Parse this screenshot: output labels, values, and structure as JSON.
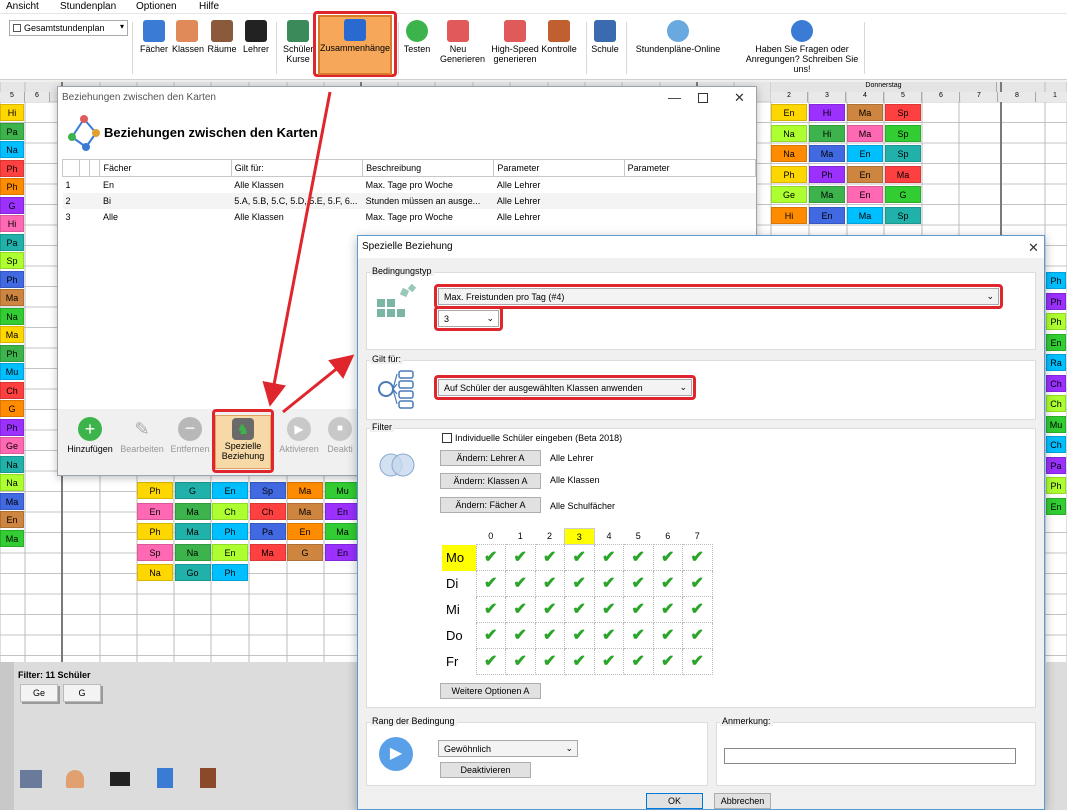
{
  "menu": [
    "Ansicht",
    "Stundenplan",
    "Optionen",
    "Hilfe"
  ],
  "plan_select": "Gesamtstundenplan",
  "toolbar": [
    {
      "label": "Fächer",
      "icon": "subjects-book-icon",
      "color": "#3a7bd5"
    },
    {
      "label": "Klassen",
      "icon": "classes-people-icon",
      "color": "#e08a5a"
    },
    {
      "label": "Räume",
      "icon": "rooms-door-icon",
      "color": "#8a5a3a"
    },
    {
      "label": "Lehrer",
      "icon": "teacher-hat-icon",
      "color": "#222"
    },
    {
      "label": "Schüler\nKurse",
      "icon": "students-icon",
      "color": "#3a8a5a"
    },
    {
      "label": "Zusammenhänge",
      "icon": "relations-network-icon",
      "color": "#2a6ad0"
    },
    {
      "label": "Testen",
      "icon": "test-check-icon",
      "color": "#3cb44b"
    },
    {
      "label": "Neu\nGenerieren",
      "icon": "generate-icon",
      "color": "#e05a5a"
    },
    {
      "label": "High-Speed\ngenerieren",
      "icon": "highspeed-icon",
      "color": "#e05a5a"
    },
    {
      "label": "Kontrolle",
      "icon": "gavel-icon",
      "color": "#c06030"
    },
    {
      "label": "Schule",
      "icon": "school-building-icon",
      "color": "#3a6ab0"
    },
    {
      "label": "Stundenpläne-Online",
      "icon": "cloud-icon",
      "color": "#6aa8e0"
    },
    {
      "label": "Haben Sie Fragen oder\nAnregungen? Schreiben Sie uns!",
      "icon": "question-icon",
      "color": "#3a7bd5"
    }
  ],
  "grid": {
    "day_header": "Donnerstag",
    "period_labels_left": [
      "5",
      "6"
    ],
    "period_labels_right": [
      "2",
      "3",
      "4",
      "5",
      "6",
      "7",
      "8",
      "1"
    ]
  },
  "dialog1": {
    "window_title": "Beziehungen zwischen den Karten",
    "heading": "Beziehungen zwischen den Karten",
    "columns": [
      "Fächer",
      "Gilt für:",
      "Beschreibung",
      "Parameter",
      "Parameter"
    ],
    "rows": [
      {
        "nr": "1",
        "subject": "En",
        "applies": "Alle Klassen",
        "desc": "Max. Tage pro Woche",
        "param": "Alle Lehrer"
      },
      {
        "nr": "2",
        "subject": "Bi",
        "applies": "5.A, 5.B, 5.C, 5.D, 5.E, 5.F, 6...",
        "desc": "Stunden müssen an ausge...",
        "param": "Alle Lehrer"
      },
      {
        "nr": "3",
        "subject": "Alle",
        "applies": "Alle Klassen",
        "desc": "Max. Tage pro Woche",
        "param": "Alle Lehrer"
      }
    ],
    "buttons": {
      "add": "Hinzufügen",
      "edit": "Bearbeiten",
      "remove": "Entfernen",
      "special": "Spezielle\nBeziehung",
      "activate": "Aktivieren",
      "deactivate": "Deakti"
    }
  },
  "dialog2": {
    "window_title": "Spezielle Beziehung",
    "type_group": "Bedingungstyp",
    "type_value": "Max. Freistunden pro Tag (#4)",
    "count_value": "3",
    "applies_group": "Gilt für:",
    "applies_value": "Auf Schüler der ausgewählten Klassen anwenden",
    "filter_group": "Filter",
    "individual_label": "Individuelle Schüler eingeben (Beta 2018)",
    "teacher_btn": "Ändern: Lehrer A",
    "teacher_val": "Alle Lehrer",
    "class_btn": "Ändern: Klassen A",
    "class_val": "Alle Klassen",
    "subject_btn": "Ändern: Fächer A",
    "subject_val": "Alle Schulfächer",
    "periods": [
      "0",
      "1",
      "2",
      "3",
      "4",
      "5",
      "6",
      "7"
    ],
    "days": [
      "Mo",
      "Di",
      "Mi",
      "Do",
      "Fr"
    ],
    "more_btn": "Weitere Optionen A",
    "rank_group": "Rang der Bedingung",
    "rank_value": "Gewöhnlich",
    "deactivate_btn": "Deaktivieren",
    "note_group": "Anmerkung:",
    "ok": "OK",
    "cancel": "Abbrechen"
  },
  "bottom": {
    "filter": "Filter: 11 Schüler",
    "cards": [
      "Ge",
      "G"
    ]
  }
}
